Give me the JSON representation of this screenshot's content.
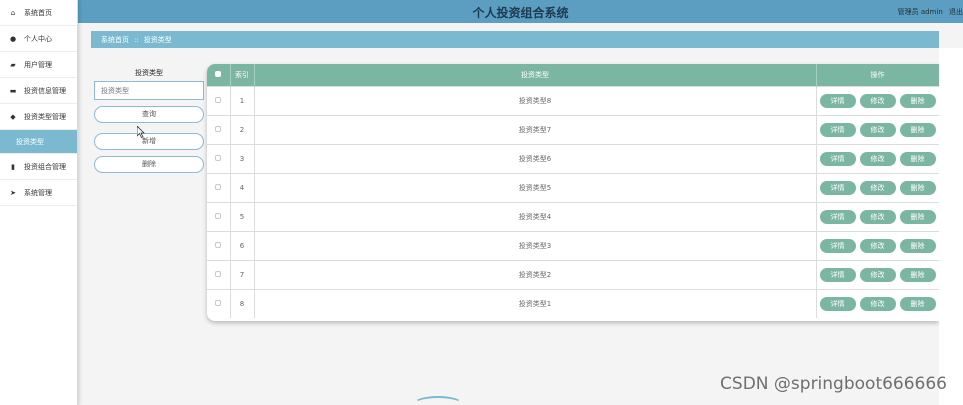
{
  "header": {
    "title": "个人投资组合系统",
    "user_text": "管理员 admin",
    "logout": "退出"
  },
  "sidebar": {
    "items": [
      {
        "label": "系统首页",
        "icon": "home-icon",
        "glyph": "⌂"
      },
      {
        "label": "个人中心",
        "icon": "user-icon",
        "glyph": "●"
      },
      {
        "label": "用户管理",
        "icon": "users-icon",
        "glyph": "▰"
      },
      {
        "label": "投资信息管理",
        "icon": "card-icon",
        "glyph": "▬"
      },
      {
        "label": "投资类型管理",
        "icon": "tag-icon",
        "glyph": "◆"
      },
      {
        "label": "投资类型",
        "icon": "",
        "glyph": ""
      },
      {
        "label": "投资组合管理",
        "icon": "bar-chart-icon",
        "glyph": "▮"
      },
      {
        "label": "系统管理",
        "icon": "send-icon",
        "glyph": "➤"
      }
    ]
  },
  "breadcrumb": {
    "home": "系统首页",
    "separator": "::",
    "current": "投资类型"
  },
  "search": {
    "label": "投资类型",
    "placeholder": "投资类型",
    "query_button": "查询",
    "add_button": "新增",
    "delete_button": "删除"
  },
  "table": {
    "columns": [
      "索引",
      "投资类型",
      "操作"
    ],
    "row_actions": [
      "详情",
      "修改",
      "删除"
    ],
    "rows": [
      {
        "index": "1",
        "type": "投资类型8"
      },
      {
        "index": "2",
        "type": "投资类型7"
      },
      {
        "index": "3",
        "type": "投资类型6"
      },
      {
        "index": "4",
        "type": "投资类型5"
      },
      {
        "index": "5",
        "type": "投资类型4"
      },
      {
        "index": "6",
        "type": "投资类型3"
      },
      {
        "index": "7",
        "type": "投资类型2"
      },
      {
        "index": "8",
        "type": "投资类型1"
      }
    ]
  },
  "watermark": "CSDN @springboot666666",
  "colors": {
    "header": "#5b9ec1",
    "accent": "#7ab9cf",
    "table_header": "#7bb6a2"
  }
}
